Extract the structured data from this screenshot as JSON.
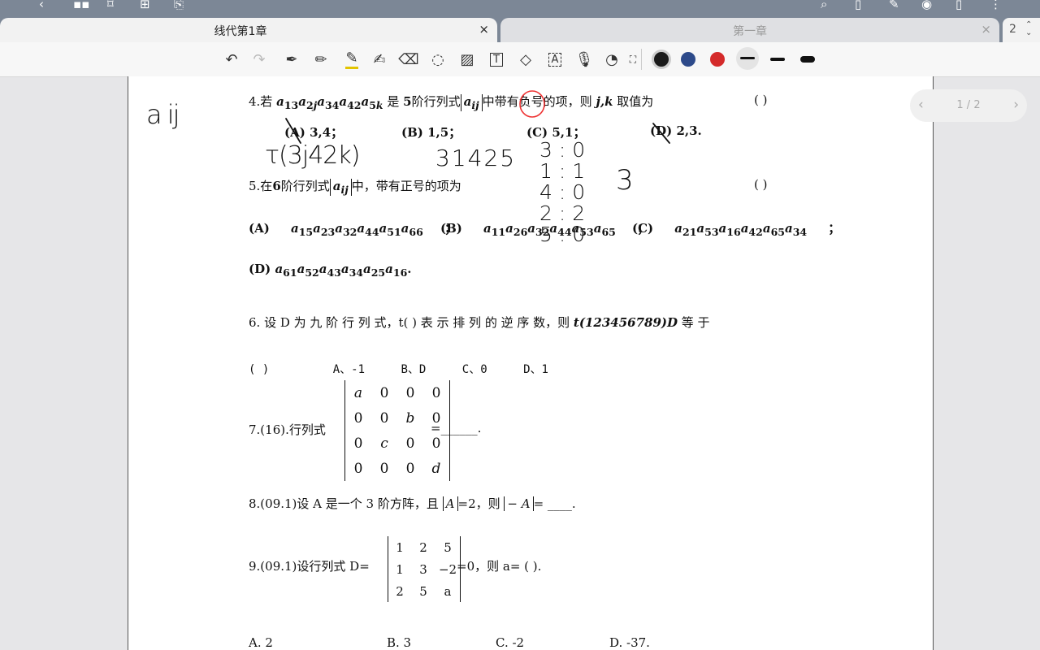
{
  "tabs": [
    {
      "label": "线代第1章",
      "close": "×"
    },
    {
      "label": "第一章",
      "close": "×"
    }
  ],
  "tab_count": "2",
  "pager": {
    "text": "1 / 2"
  },
  "colors": {
    "pen_black": "#1a1a1a",
    "pen_blue": "#2d4a8a",
    "pen_red": "#d42a2a",
    "annotation_red": "#e33"
  },
  "toolbar_icons": [
    "undo-icon",
    "redo-icon",
    "pen-icon",
    "pencil-icon",
    "highlighter-icon",
    "marker-icon",
    "eraser-icon",
    "lasso-icon",
    "image-icon",
    "text-icon",
    "shape-icon",
    "ocr-icon",
    "mic-icon",
    "sticker-icon",
    "crop-icon"
  ],
  "doc": {
    "q4": {
      "num": "4.若",
      "mid": "是",
      "n": "5",
      "mid2": "阶行列式",
      "aij": "a",
      "aij_sub": "ij",
      "tail": "中带有负号的项，则",
      "jk": "j,k",
      "tail2": "取值为",
      "paren": "(        )",
      "opts": [
        {
          "label": "(A)",
          "val": "3,4；"
        },
        {
          "label": "(B)",
          "val": "1,5；"
        },
        {
          "label": "(C)",
          "val": "5,1；"
        },
        {
          "label": "(D)",
          "val": "2,3."
        }
      ]
    },
    "q5": {
      "num": "5.在",
      "n": "6",
      "mid": "阶行列式",
      "tail": "中，带有正号的项为",
      "paren": "(        )",
      "A": "(A)",
      "B": "(B)",
      "C": "(C)",
      "D": "(D)",
      "sep": "；",
      "end": "."
    },
    "q6": {
      "text": "6. 设 D 为 九 阶 行 列 式，t( ) 表 示 排 列 的 逆 序 数，则",
      "expr": "t(123456789)D",
      "tail": "等 于",
      "paren": "(        )",
      "opts": [
        "A、-1",
        "B、D",
        "C、0",
        "D、1"
      ]
    },
    "q7": {
      "label": "7.(16).行列式",
      "eq": "=______.",
      "matrix": [
        [
          "a",
          "0",
          "0",
          "0"
        ],
        [
          "0",
          "0",
          "b",
          "0"
        ],
        [
          "0",
          "c",
          "0",
          "0"
        ],
        [
          "0",
          "0",
          "0",
          "d"
        ]
      ]
    },
    "q8": {
      "label": "8.(09.1)设 A 是一个 3 阶方阵，且",
      "detA": "A",
      "mid": "=2，则",
      "neg": "− A",
      "end": "= ____."
    },
    "q9": {
      "label": "9.(09.1)设行列式 D=",
      "matrix": [
        [
          "1",
          "2",
          "5"
        ],
        [
          "1",
          "3",
          "−2"
        ],
        [
          "2",
          "5",
          "a"
        ]
      ],
      "tail": "=0，则 a= (        ).",
      "opts": [
        "A. 2",
        "B. 3",
        "C. -2",
        "D. -37."
      ]
    }
  },
  "handwriting": {
    "aij": "a ij",
    "perm": "τ(3j42k)",
    "perm2": "31425",
    "col": [
      "3 : 0",
      "1 : 1",
      "4 : 0",
      "2 : 2",
      "5 : 0"
    ],
    "three": "3"
  }
}
